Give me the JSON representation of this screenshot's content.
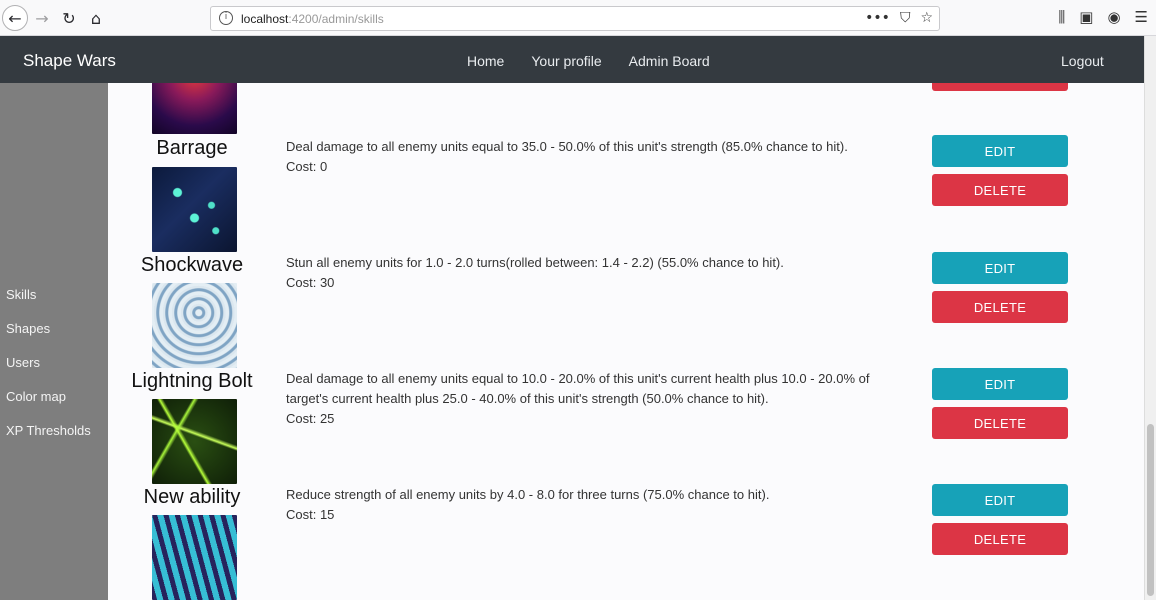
{
  "browser": {
    "url_host": "localhost",
    "url_rest": ":4200/admin/skills",
    "back_icon": "arrow-left",
    "forward_icon": "arrow-right",
    "reload_icon": "reload",
    "home_icon": "home"
  },
  "navbar": {
    "brand": "Shape Wars",
    "links": [
      "Home",
      "Your profile",
      "Admin Board"
    ],
    "logout": "Logout"
  },
  "sidebar": {
    "items": [
      "Skills",
      "Shapes",
      "Users",
      "Color map",
      "XP Thresholds"
    ]
  },
  "skills": [
    {
      "name": "Barrage",
      "description": "Deal damage to all enemy units equal to 35.0 - 50.0% of this unit's strength (85.0% chance to hit).",
      "cost": "Cost: 0"
    },
    {
      "name": "Shockwave",
      "description": "Stun all enemy units for 1.0 - 2.0 turns(rolled between: 1.4 - 2.2) (55.0% chance to hit).",
      "cost": "Cost: 30"
    },
    {
      "name": "Lightning Bolt",
      "description_line1": "Deal damage to all enemy units equal to 10.0 - 20.0% of this unit's current health plus 10.0 - 20.0% of",
      "description_line2": "target's current health plus 25.0 - 40.0% of this unit's strength (50.0% chance to hit).",
      "cost": "Cost: 25"
    },
    {
      "name": "New ability",
      "description": "Reduce strength of all enemy units by 4.0 - 8.0 for three turns (75.0% chance to hit).",
      "cost": "Cost: 15"
    }
  ],
  "buttons": {
    "edit": "EDIT",
    "delete": "DELETE"
  },
  "colors": {
    "navbar": "#343a40",
    "sidebar": "#7e7e7e",
    "edit": "#17a2b8",
    "delete": "#dc3545"
  }
}
